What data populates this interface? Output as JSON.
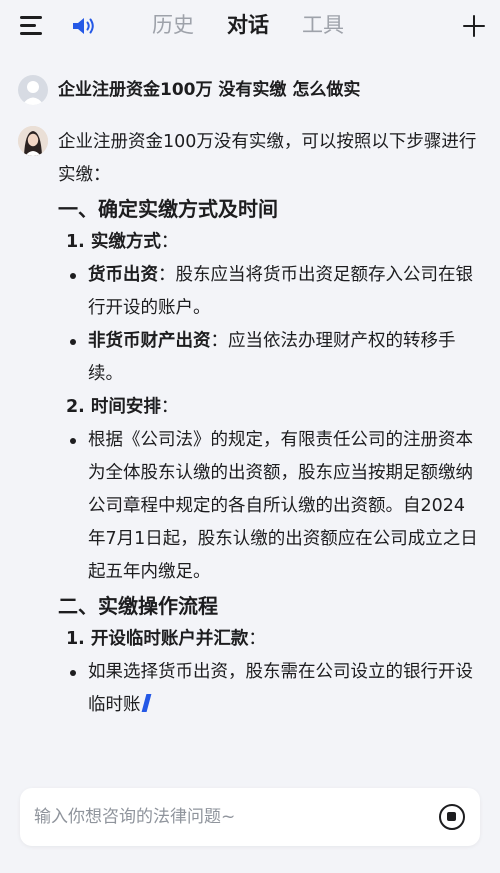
{
  "header": {
    "tabs": [
      {
        "label": "历史"
      },
      {
        "label": "对话"
      },
      {
        "label": "工具"
      }
    ],
    "active_tab": "对话",
    "icons": [
      "menu-icon",
      "speaker-icon",
      "plus-icon"
    ]
  },
  "user_message": "企业注册资金100万 没有实缴 怎么做实",
  "answer": {
    "intro": "企业注册资金100万没有实缴，可以按照以下步骤进行实缴：",
    "section1": {
      "heading": "一、确定实缴方式及时间",
      "item1": {
        "number": "1.",
        "title": "实缴方式",
        "colon": "：",
        "bullets": [
          {
            "bold": "货币出资",
            "text": "：股东应当将货币出资足额存入公司在银行开设的账户。"
          },
          {
            "bold": "非货币财产出资",
            "text": "：应当依法办理财产权的转移手续。"
          }
        ]
      },
      "item2": {
        "number": "2.",
        "title": "时间安排",
        "colon": "：",
        "bullets": [
          {
            "text": "根据《公司法》的规定，有限责任公司的注册资本为全体股东认缴的出资额，股东应当按期足额缴纳公司章程中规定的各自所认缴的出资额。自2024年7月1日起，股东认缴的出资额应在公司成立之日起五年内缴足。"
          }
        ]
      }
    },
    "section2": {
      "heading": "二、实缴操作流程",
      "item1": {
        "number": "1.",
        "title": "开设临时账户并汇款",
        "colon": "：",
        "bullets": [
          {
            "text": "如果选择货币出资，股东需在公司设立的银行开设临时账"
          }
        ]
      }
    }
  },
  "input": {
    "placeholder": "输入你想咨询的法律问题~",
    "value": ""
  },
  "colors": {
    "background": "#f3f4f8",
    "accent": "#2458e6",
    "inactive_tab": "#9ea2aa",
    "text": "#1d1d1f"
  }
}
